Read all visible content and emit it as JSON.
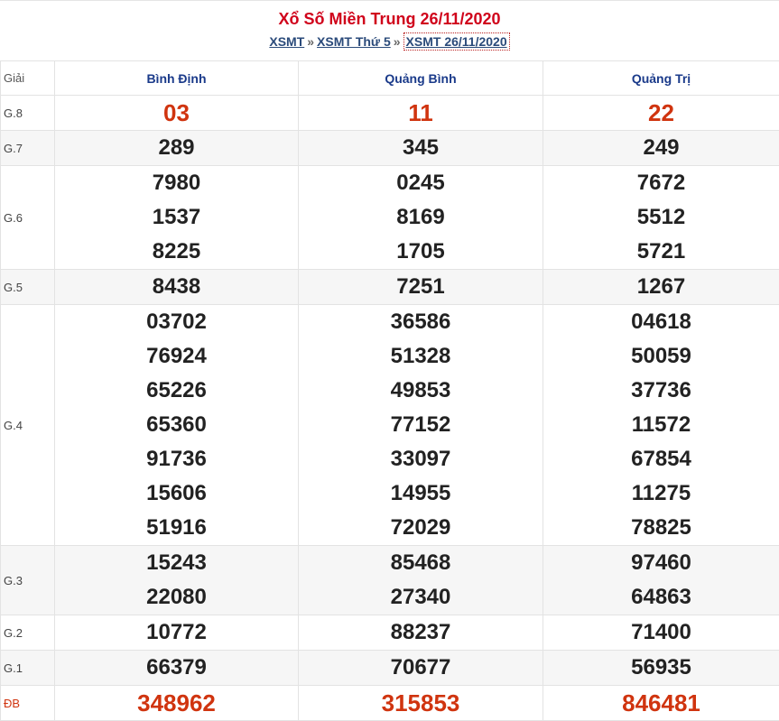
{
  "header": {
    "title": "Xổ Số Miền Trung 26/11/2020",
    "breadcrumb": [
      {
        "label": "XSMT"
      },
      {
        "label": "XSMT Thứ 5"
      },
      {
        "label": "XSMT 26/11/2020"
      }
    ],
    "separator": "»"
  },
  "table": {
    "giai_header": "Giải",
    "provinces": [
      "Bình Định",
      "Quảng Bình",
      "Quảng Trị"
    ],
    "rows": [
      {
        "label": "G.8",
        "values": [
          [
            "03"
          ],
          [
            "11"
          ],
          [
            "22"
          ]
        ]
      },
      {
        "label": "G.7",
        "values": [
          [
            "289"
          ],
          [
            "345"
          ],
          [
            "249"
          ]
        ]
      },
      {
        "label": "G.6",
        "values": [
          [
            "7980",
            "1537",
            "8225"
          ],
          [
            "0245",
            "8169",
            "1705"
          ],
          [
            "7672",
            "5512",
            "5721"
          ]
        ]
      },
      {
        "label": "G.5",
        "values": [
          [
            "8438"
          ],
          [
            "7251"
          ],
          [
            "1267"
          ]
        ]
      },
      {
        "label": "G.4",
        "values": [
          [
            "03702",
            "76924",
            "65226",
            "65360",
            "91736",
            "15606",
            "51916"
          ],
          [
            "36586",
            "51328",
            "49853",
            "77152",
            "33097",
            "14955",
            "72029"
          ],
          [
            "04618",
            "50059",
            "37736",
            "11572",
            "67854",
            "11275",
            "78825"
          ]
        ]
      },
      {
        "label": "G.3",
        "values": [
          [
            "15243",
            "22080"
          ],
          [
            "85468",
            "27340"
          ],
          [
            "97460",
            "64863"
          ]
        ]
      },
      {
        "label": "G.2",
        "values": [
          [
            "10772"
          ],
          [
            "88237"
          ],
          [
            "71400"
          ]
        ]
      },
      {
        "label": "G.1",
        "values": [
          [
            "66379"
          ],
          [
            "70677"
          ],
          [
            "56935"
          ]
        ]
      },
      {
        "label": "ĐB",
        "values": [
          [
            "348962"
          ],
          [
            "315853"
          ],
          [
            "846481"
          ]
        ]
      }
    ]
  },
  "colors": {
    "title": "#d0021b",
    "prize_red": "#d0340f",
    "province": "#1a3a8a",
    "link": "#2a4a7a"
  }
}
